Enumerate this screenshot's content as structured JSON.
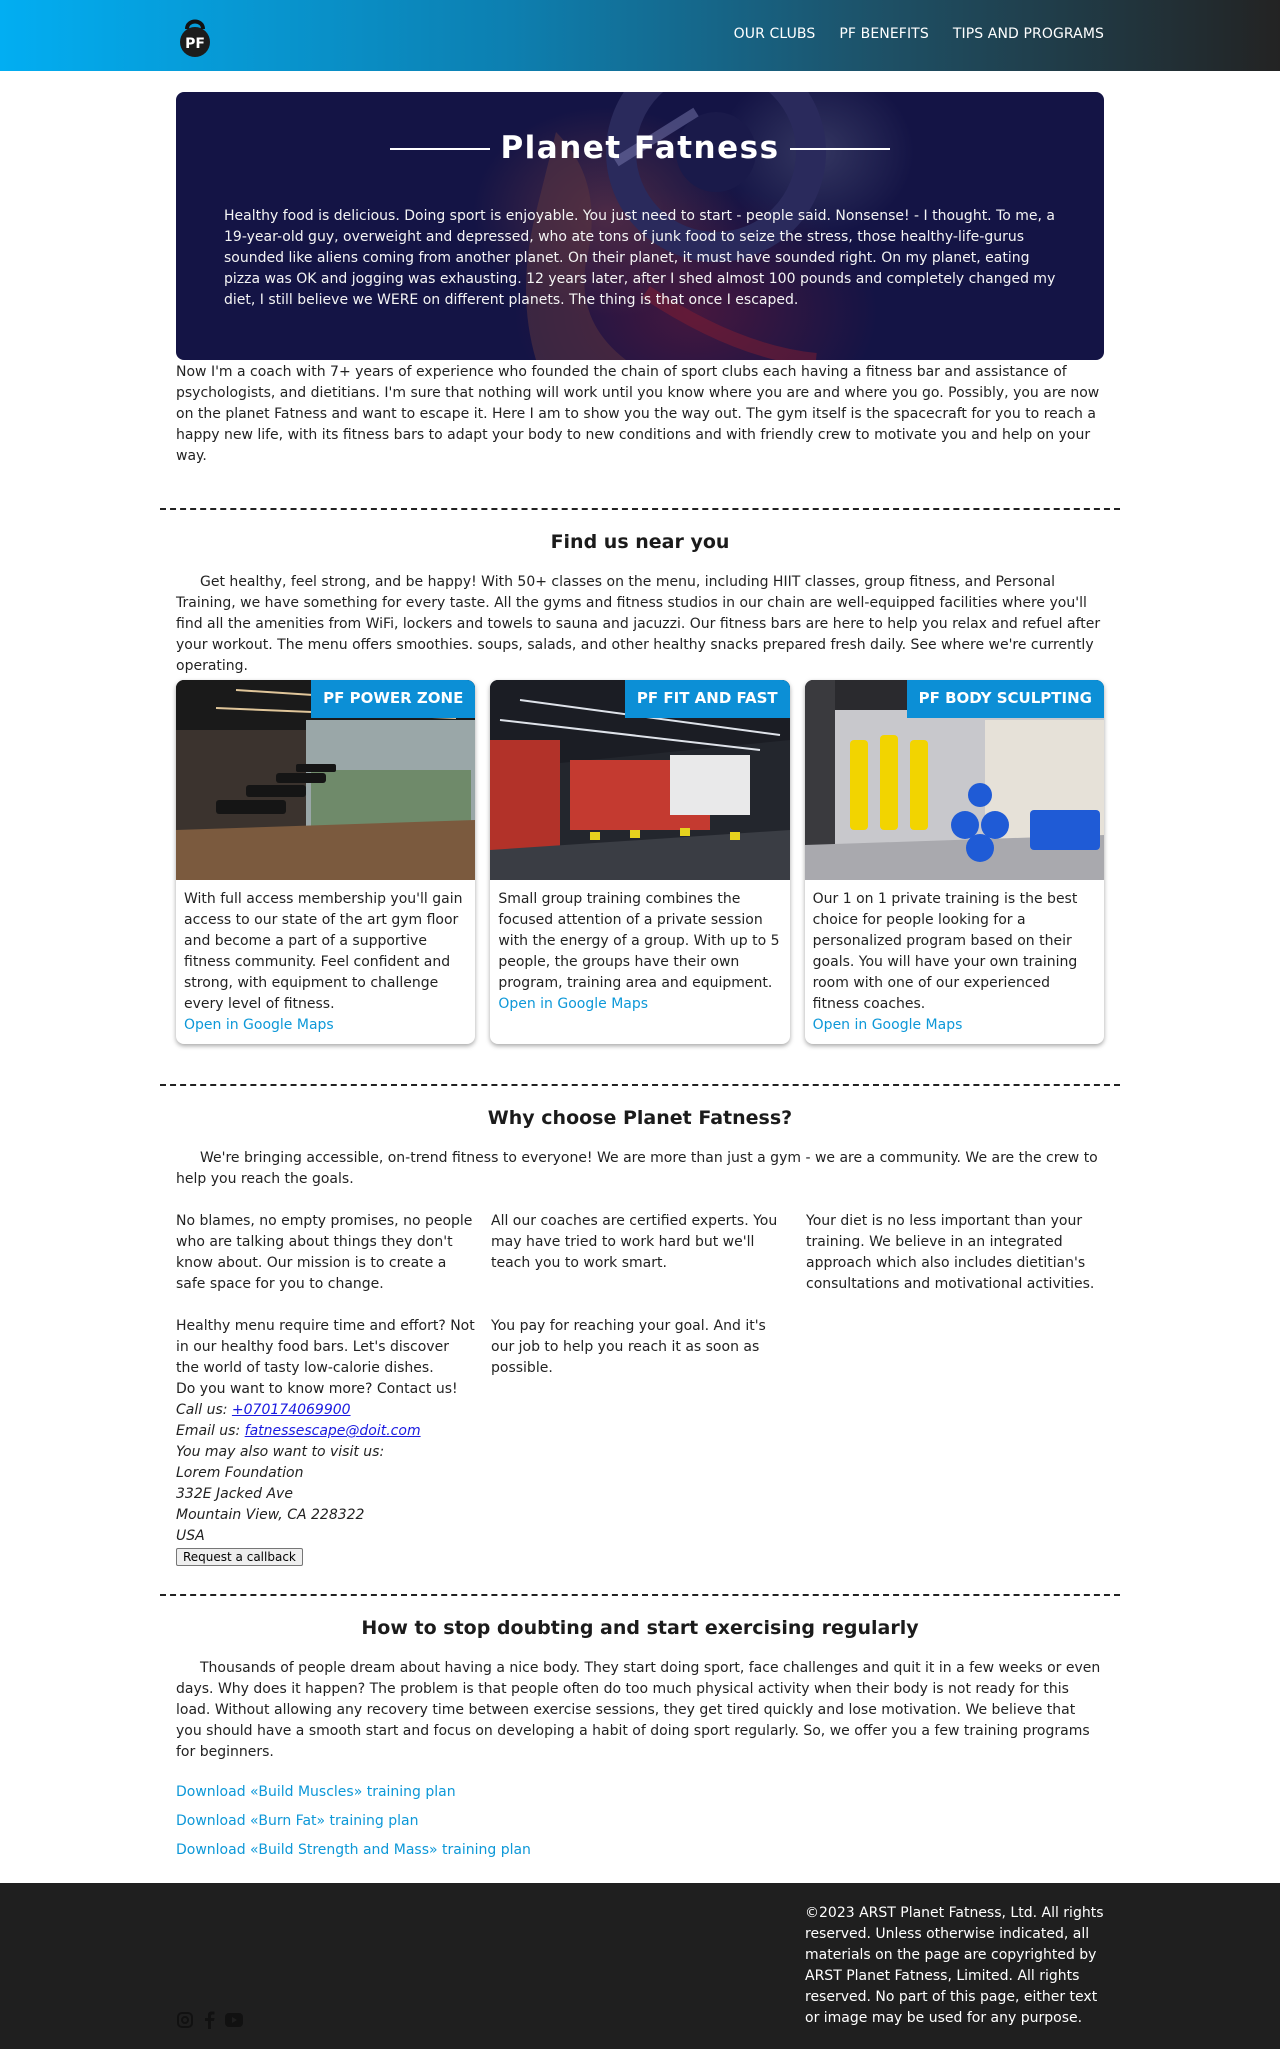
{
  "nav": {
    "logo_text": "PF",
    "items": [
      "OUR CLUBS",
      "PF BENEFITS",
      "TIPS AND PROGRAMS"
    ]
  },
  "hero": {
    "title": "Planet Fatness",
    "text": "Healthy food is delicious. Doing sport is enjoyable. You just need to start - people said. Nonsense! - I thought. To me, a 19-year-old guy, overweight and depressed, who ate tons of junk food to seize the stress, those healthy-life-gurus sounded like aliens coming from another planet. On their planet, it must have sounded right. On my planet, eating pizza was OK and jogging was exhausting. 12 years later, after I shed almost 100 pounds and completely changed my diet, I still believe we WERE on different planets. The thing is that once I escaped."
  },
  "intro": "Now I'm a coach with 7+ years of experience who founded the chain of sport clubs each having a fitness bar and assistance of psychologists, and dietitians. I'm sure that nothing will work until you know where you are and where you go. Possibly, you are now on the planet Fatness and want to escape it. Here I am to show you the way out. The gym itself is the spacecraft for you to reach a happy new life, with its fitness bars to adapt your body to new conditions and with friendly crew to motivate you and help on your way.",
  "find": {
    "title": "Find us near you",
    "text": "Get healthy, feel strong, and be happy! With 50+ classes on the menu, including HIIT classes, group fitness, and Personal Training, we have something for every taste. All the gyms and fitness studios in our chain are well-equipped facilities where you'll find all the amenities from WiFi, lockers and towels to sauna and jacuzzi. Our fitness bars are here to help you relax and refuel after your workout. The menu offers smoothies. soups, salads, and other healthy snacks prepared fresh daily. See where we're currently operating.",
    "cards": [
      {
        "badge": "PF POWER ZONE",
        "text": "With full access membership you'll gain access to our state of the art gym floor and become a part of a supportive fitness community. Feel confident and strong, with equipment to challenge every level of fitness.",
        "link": "Open in Google Maps"
      },
      {
        "badge": "PF FIT AND FAST",
        "text": "Small group training combines the focused attention of a private session with the energy of a group. With up to 5 people, the groups have their own program, training area and equipment.",
        "link": "Open in Google Maps"
      },
      {
        "badge": "PF BODY SCULPTING",
        "text": "Our 1 on 1 private training is the best choice for people looking for a personalized program based on their goals. You will have your own training room with one of our experienced fitness coaches.",
        "link": "Open in Google Maps"
      }
    ]
  },
  "why": {
    "title": "Why choose Planet Fatness?",
    "text": "We're bringing accessible, on-trend fitness to everyone! We are more than just a gym - we are a community. We are the crew to help you reach the goals.",
    "cells": [
      "No blames, no empty promises, no people who are talking about things they don't know about. Our mission is to create a safe space for you to change.",
      "All our coaches are certified experts. You may have tried to work hard but we'll teach you to work smart.",
      "Your diet is no less important than your training. We believe in an integrated approach which also includes dietitian's consultations and motivational activities.",
      "Healthy menu require time and effort? Not in our healthy food bars. Let's discover the world of tasty low-calorie dishes.",
      "You pay for reaching your goal. And it's our job to help you reach it as soon as possible."
    ],
    "contact": {
      "question": "Do you want to know more? Contact us!",
      "call_label": "Call us: ",
      "phone": "+070174069900",
      "email_label": "Email us: ",
      "email": "fatnessescape@doit.com",
      "visit": "You may also want to visit us:",
      "address": [
        "Lorem Foundation",
        "332E Jacked Ave",
        "Mountain View, CA 228322",
        "USA"
      ],
      "button": "Request a callback"
    }
  },
  "tips": {
    "title": "How to stop doubting and start exercising regularly",
    "text": "Thousands of people dream about having a nice body. They start doing sport, face challenges and quit it in a few weeks or even days. Why does it happen? The problem is that people often do too much physical activity when their body is not ready for this load. Without allowing any recovery time between exercise sessions, they get tired quickly and lose motivation. We believe that you should have a smooth start and focus on developing a habit of doing sport regularly. So, we offer you a few training programs for beginners.",
    "downloads": [
      "Download «Build Muscles» training plan",
      "Download «Burn Fat» training plan",
      "Download «Build Strength and Mass» training plan"
    ]
  },
  "footer": {
    "copyright": "©2023 ARST Planet Fatness, Ltd. All rights reserved. Unless otherwise indicated, all materials on the page are copyrighted by ARST Planet Fatness, Limited. All rights reserved. No part of this page, either text or image may be used for any purpose.",
    "socials": [
      "instagram-icon",
      "facebook-icon",
      "youtube-icon"
    ]
  },
  "colors": {
    "accent": "#0c8fd6",
    "header_start": "#02aef2",
    "header_end": "#232323",
    "hero_bg": "#141445",
    "footer_bg": "#1f1f1f"
  }
}
